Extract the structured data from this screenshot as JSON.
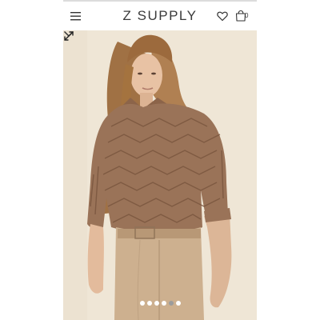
{
  "header": {
    "brand": "Z SUPPLY",
    "cart_count": "0",
    "icons": [
      "hamburger-menu-icon",
      "heart-icon",
      "shopping-bag-icon"
    ]
  },
  "gallery": {
    "image_count": 6,
    "active_index": 4,
    "icons": [
      "chevron-down-icon",
      "expand-icon"
    ]
  },
  "colors": {
    "brand_text": "#3a3a3a",
    "sweater": "#9a7358",
    "pants": "#cdb08f",
    "backdrop": "#efe6d6"
  }
}
